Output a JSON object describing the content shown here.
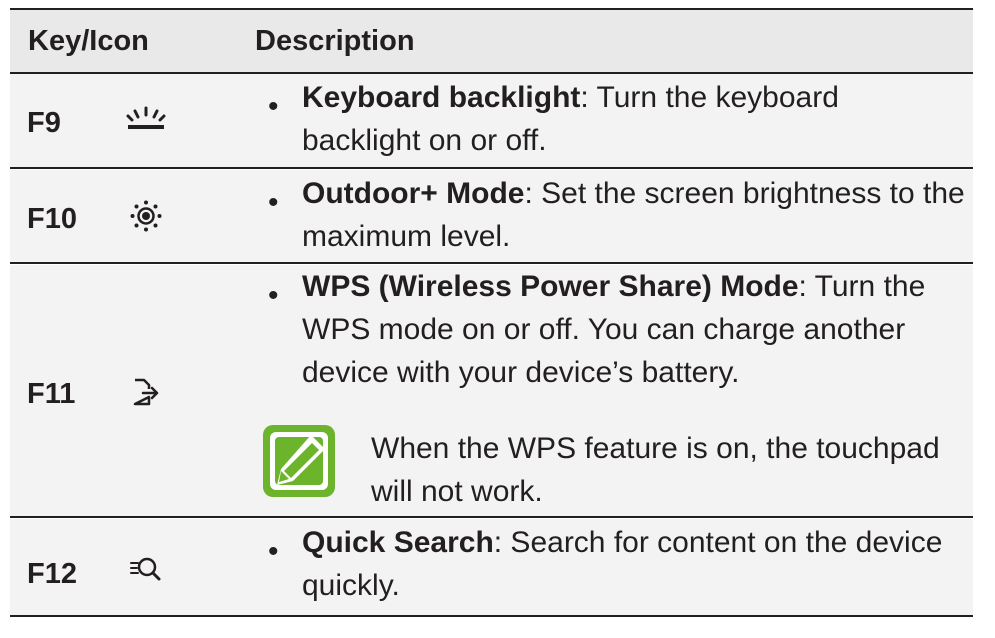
{
  "header": {
    "key_label": "Key/Icon",
    "desc_label": "Description"
  },
  "rows": [
    {
      "key": "F9",
      "icon": "keyboard-backlight-icon",
      "bullet": "•",
      "title": "Keyboard backlight",
      "text": ": Turn the keyboard backlight on or off."
    },
    {
      "key": "F10",
      "icon": "outdoor-mode-icon",
      "bullet": "•",
      "title": "Outdoor+ Mode",
      "text": ": Set the screen brightness to the maximum level."
    },
    {
      "key": "F11",
      "icon": "wireless-power-share-icon",
      "bullet": "•",
      "title": "WPS (Wireless Power Share) Mode",
      "text": ": Turn the WPS mode on or off. You can charge another device with your device’s battery.",
      "note": "When the WPS feature is on, the touchpad will not work.",
      "note_icon": "note-pencil-icon",
      "note_color": "#6bb42b"
    },
    {
      "key": "F12",
      "icon": "quick-search-icon",
      "bullet": "•",
      "title": "Quick Search",
      "text": ": Search for content on the device quickly."
    }
  ]
}
